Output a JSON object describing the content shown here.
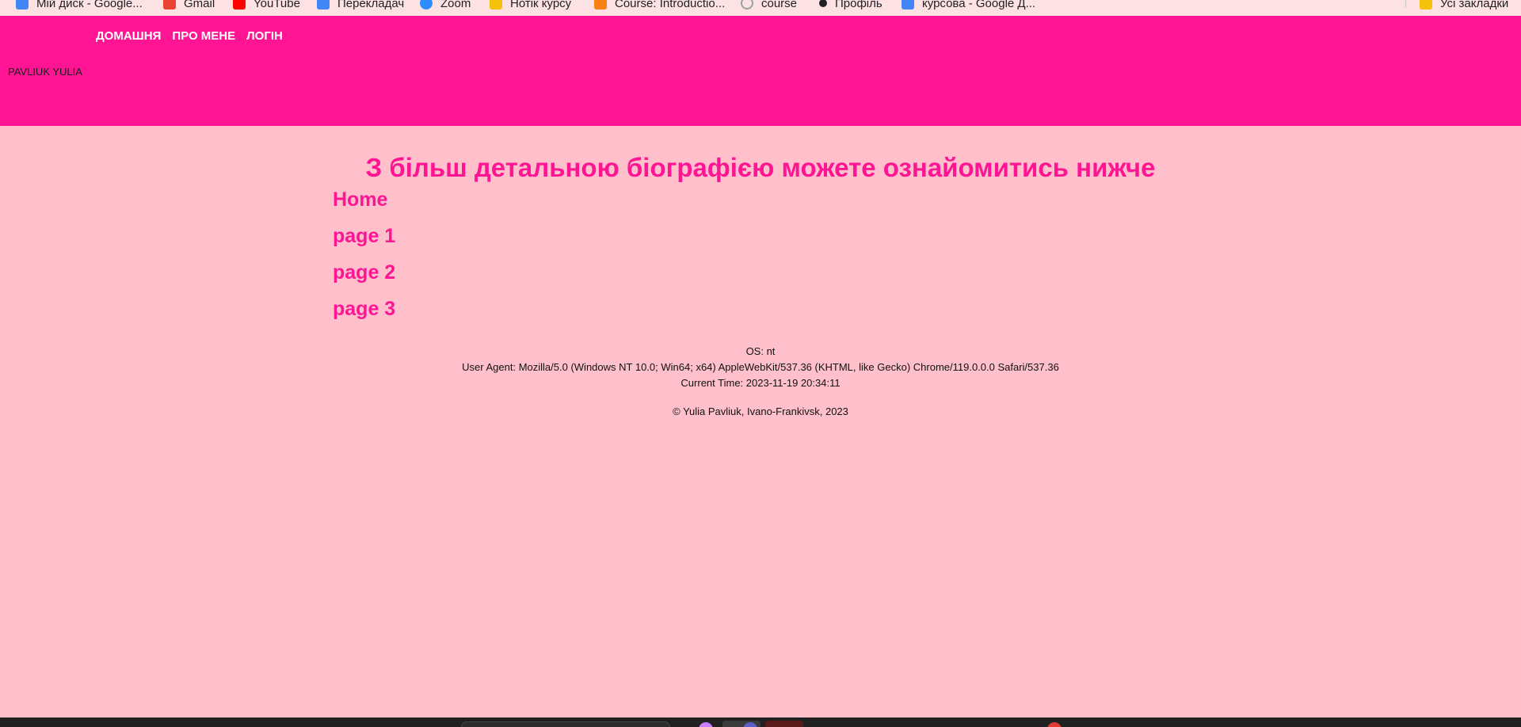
{
  "bookmarks": [
    {
      "label": "Мій диск - Google...",
      "icon": "google-drive-icon",
      "color": "#4285f4"
    },
    {
      "label": "Gmail",
      "icon": "gmail-icon",
      "color": "#ea4335"
    },
    {
      "label": "YouTube",
      "icon": "youtube-icon",
      "color": "#ff0000"
    },
    {
      "label": "Перекладач",
      "icon": "google-translate-icon",
      "color": "#4285f4"
    },
    {
      "label": "Zoom",
      "icon": "zoom-icon",
      "color": "#2d8cff"
    },
    {
      "label": "Нотік курсу",
      "icon": "notebook-icon",
      "color": "#f4c20d"
    },
    {
      "label": "Course: Introductio...",
      "icon": "moodle-icon",
      "color": "#f98012"
    },
    {
      "label": "course",
      "icon": "loading-icon",
      "color": "#9aa0a6"
    },
    {
      "label": "Профіль",
      "icon": "profile-icon",
      "color": "#202124"
    },
    {
      "label": "курсова - Google Д...",
      "icon": "google-docs-icon",
      "color": "#4285f4"
    }
  ],
  "bookmarks_other": {
    "label": "Усі закладки",
    "icon": "folder-icon",
    "color": "#f4c20d"
  },
  "header": {
    "nav": [
      "ДОМАШНЯ",
      "ПРО МЕНЕ",
      "ЛОГІН"
    ],
    "brand": "PAVLIUK YULIA"
  },
  "main": {
    "heading": "З більш детальною біографією можете ознайомитись нижче",
    "links": [
      "Home",
      "page 1",
      "page 2",
      "page 3"
    ]
  },
  "sysinfo": {
    "os": "OS: nt",
    "user_agent": "User Agent: Mozilla/5.0 (Windows NT 10.0; Win64; x64) AppleWebKit/537.36 (KHTML, like Gecko) Chrome/119.0.0.0 Safari/537.36",
    "time": "Current Time: 2023-11-19 20:34:11"
  },
  "footer": {
    "copyright": "© Yulia Pavliuk, Ivano-Frankivsk, 2023"
  },
  "colors": {
    "accent": "#ff1493",
    "background": "#ffc0cb",
    "taskbar": "#202020"
  }
}
